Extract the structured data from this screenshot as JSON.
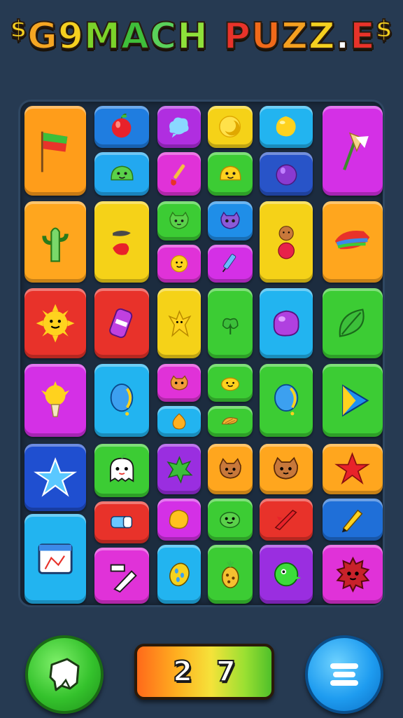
{
  "title": {
    "word1": "G9MACH",
    "word2": "PUZZ.E",
    "left_ornament": "$",
    "right_ornament": "$",
    "word1_colors": [
      "#f5a623",
      "#f5d020",
      "#7bd32a",
      "#3fbf3a",
      "#5ad15a",
      "#8fe03a"
    ],
    "word2_colors": [
      "#e8332a",
      "#f06a1a",
      "#f5a020",
      "#f5d020",
      "#ffffff",
      "#e8332a"
    ]
  },
  "tiles": [
    {
      "name": "flag-tile",
      "color": "#ff9d1a",
      "icon": "flag-icon"
    },
    {
      "name": "apple-tile",
      "color": "#1f7de0",
      "icon": "apple-icon"
    },
    {
      "name": "cloud-blob-tile",
      "color": "#b02ee0",
      "icon": "cloud-blob-icon"
    },
    {
      "name": "moon-tile",
      "color": "#f5d218",
      "icon": "moon-icon"
    },
    {
      "name": "lemon-drop-tile",
      "color": "#22b4f0",
      "icon": "lemon-drop-icon"
    },
    {
      "name": "axe-tile",
      "color": "#d430e6",
      "icon": "axe-icon"
    },
    {
      "name": "green-slime-tile",
      "color": "#22a8f0",
      "icon": "green-slime-icon"
    },
    {
      "name": "paintbrush-tile",
      "color": "#e032d8",
      "icon": "paintbrush-icon"
    },
    {
      "name": "yellow-slime-tile",
      "color": "#3ccc34",
      "icon": "yellow-slime-icon"
    },
    {
      "name": "plum-tile",
      "color": "#2854c8",
      "icon": "plum-icon"
    },
    {
      "name": "cactus-tile",
      "color": "#ffa61e",
      "icon": "cactus-icon"
    },
    {
      "name": "pepper-tile",
      "color": "#f5d218",
      "icon": "pepper-icon"
    },
    {
      "name": "green-cat-tile",
      "color": "#3ccc34",
      "icon": "green-cat-icon"
    },
    {
      "name": "purple-cat-tile",
      "color": "#1f8ee8",
      "icon": "purple-cat-icon"
    },
    {
      "name": "bear-tomato-tile",
      "color": "#f5d218",
      "icon": "bear-tomato-icon"
    },
    {
      "name": "rainbow-hat-tile",
      "color": "#ffa61e",
      "icon": "rainbow-hat-icon"
    },
    {
      "name": "sun-face-tile",
      "color": "#e032d8",
      "icon": "sun-face-icon"
    },
    {
      "name": "syringe-tile",
      "color": "#d430e6",
      "icon": "syringe-icon"
    },
    {
      "name": "sun-tile",
      "color": "#e8322a",
      "icon": "sun-icon"
    },
    {
      "name": "bandage-tile",
      "color": "#e8322a",
      "icon": "bandage-icon"
    },
    {
      "name": "yellow-star-creature-tile",
      "color": "#f5d218",
      "icon": "yellow-star-creature-icon"
    },
    {
      "name": "green-plant-tile",
      "color": "#3ccc34",
      "icon": "green-plant-icon"
    },
    {
      "name": "purple-blob-tile",
      "color": "#22b4f0",
      "icon": "purple-blob-icon"
    },
    {
      "name": "leaf-tile",
      "color": "#3ccc34",
      "icon": "leaf-icon"
    },
    {
      "name": "lightbulb-tile",
      "color": "#d430e6",
      "icon": "lightbulb-icon"
    },
    {
      "name": "balloon-tile",
      "color": "#22b4f0",
      "icon": "balloon-icon"
    },
    {
      "name": "orange-monster-tile",
      "color": "#e032d8",
      "icon": "orange-monster-icon"
    },
    {
      "name": "smile-slime-tile",
      "color": "#3ccc34",
      "icon": "smile-slime-icon"
    },
    {
      "name": "blue-balloon-tile",
      "color": "#3ccc34",
      "icon": "blue-balloon-icon"
    },
    {
      "name": "play-triangle-tile",
      "color": "#3ccc34",
      "icon": "play-triangle-icon"
    },
    {
      "name": "orange-drop-tile",
      "color": "#22b4f0",
      "icon": "orange-drop-icon"
    },
    {
      "name": "shell-tile",
      "color": "#3ccc34",
      "icon": "shell-icon"
    },
    {
      "name": "blue-star-tile",
      "color": "#1f4fd0",
      "icon": "blue-star-icon"
    },
    {
      "name": "ghost-tile",
      "color": "#3ccc34",
      "icon": "ghost-icon"
    },
    {
      "name": "green-splat-tile",
      "color": "#9a2ee0",
      "icon": "green-splat-icon"
    },
    {
      "name": "cat-face-tile",
      "color": "#ffa61e",
      "icon": "cat-face-icon"
    },
    {
      "name": "bear-face-tile",
      "color": "#ffa61e",
      "icon": "bear-face-icon"
    },
    {
      "name": "red-star-tile",
      "color": "#ffa61e",
      "icon": "red-star-icon"
    },
    {
      "name": "app-window-tile",
      "color": "#22b4f0",
      "icon": "app-window-icon"
    },
    {
      "name": "bandage-blue-tile",
      "color": "#e8322a",
      "icon": "bandage-blue-icon"
    },
    {
      "name": "yellow-blob-tile",
      "color": "#d430e6",
      "icon": "yellow-blob-icon"
    },
    {
      "name": "green-face-tile",
      "color": "#3ccc34",
      "icon": "green-face-icon"
    },
    {
      "name": "red-rocket-tile",
      "color": "#e8322a",
      "icon": "red-rocket-icon"
    },
    {
      "name": "yellow-pencil-tile",
      "color": "#1f6fd8",
      "icon": "yellow-pencil-icon"
    },
    {
      "name": "eraser-tile",
      "color": "#e032d8",
      "icon": "eraser-icon"
    },
    {
      "name": "spotted-egg-tile",
      "color": "#22b4f0",
      "icon": "spotted-egg-icon"
    },
    {
      "name": "pineapple-tile",
      "color": "#3ccc34",
      "icon": "pineapple-icon"
    },
    {
      "name": "green-bird-tile",
      "color": "#9a2ee0",
      "icon": "green-bird-icon"
    },
    {
      "name": "red-fuzzball-tile",
      "color": "#e032d8",
      "icon": "red-fuzzball-icon"
    }
  ],
  "controls": {
    "hint_icon": "shape-piece-icon",
    "menu_icon": "menu-lines-icon",
    "score_digits": [
      "2",
      "7"
    ]
  }
}
